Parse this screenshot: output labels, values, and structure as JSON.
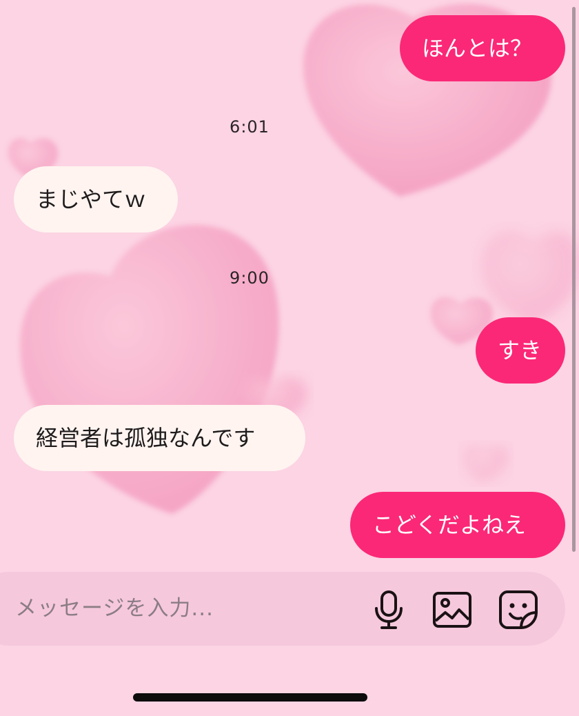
{
  "messages": [
    {
      "direction": "outgoing",
      "text": "ほんとは？"
    },
    {
      "direction": "incoming",
      "text": "まじやてｗ"
    },
    {
      "direction": "outgoing",
      "text": "すき"
    },
    {
      "direction": "incoming",
      "text": "経営者は孤独なんです"
    },
    {
      "direction": "outgoing",
      "text": "こどくだよねえ"
    }
  ],
  "timestamps": [
    "6:01",
    "9:00"
  ],
  "composer": {
    "placeholder": "メッセージを入力...",
    "buttons": [
      {
        "name": "microphone-icon"
      },
      {
        "name": "image-icon"
      },
      {
        "name": "sticker-icon"
      }
    ]
  },
  "theme": {
    "background": "#fcd4e4",
    "outgoing_bubble": "#fb2877",
    "incoming_bubble": "#fff4f0",
    "heart": "#f6a3c3"
  }
}
